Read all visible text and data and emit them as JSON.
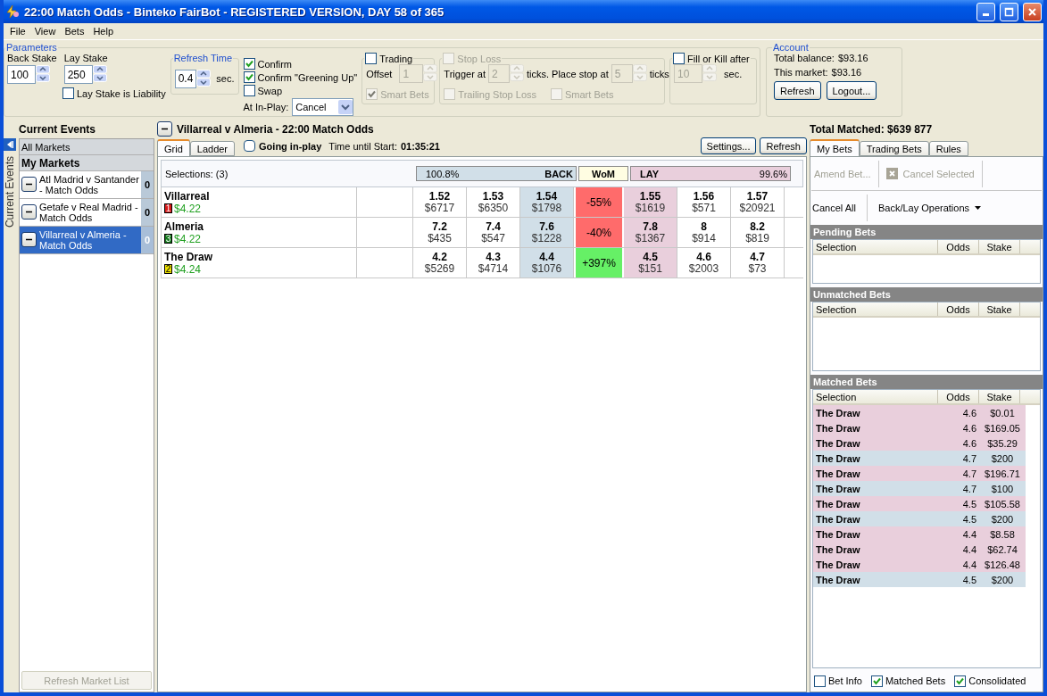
{
  "window": {
    "title": "22:00 Match Odds - Binteko FairBot - REGISTERED VERSION, DAY 58 of 365"
  },
  "menu": [
    "File",
    "View",
    "Bets",
    "Help"
  ],
  "parameters": {
    "title": "Parameters",
    "back_stake": {
      "label": "Back Stake",
      "value": "100"
    },
    "lay_stake": {
      "label": "Lay Stake",
      "value": "250"
    },
    "lay_stake_is_liability": {
      "label": "Lay Stake is Liability",
      "checked": false
    },
    "refresh_time": {
      "title": "Refresh Time",
      "value": "0.4",
      "unit": "sec."
    },
    "options": [
      {
        "label": "Confirm",
        "checked": true
      },
      {
        "label": "Confirm \"Greening Up\"",
        "checked": true
      },
      {
        "label": "Swap",
        "checked": false
      }
    ],
    "at_in_play": {
      "label": "At In-Play:",
      "value": "Cancel"
    },
    "trading": {
      "label": "Trading",
      "checked": false,
      "offset_label": "Offset",
      "offset_value": "1",
      "smart_bets": {
        "label": "Smart Bets",
        "checked": true,
        "disabled": true
      }
    },
    "stop_loss": {
      "label": "Stop Loss",
      "checked": false,
      "disabled": true,
      "trigger_label": "Trigger at",
      "trigger_value": "2",
      "trigger_unit": "ticks.",
      "place_label": "Place stop at",
      "place_value": "5",
      "place_unit": "ticks",
      "trailing": {
        "label": "Trailing Stop Loss",
        "checked": false,
        "disabled": true
      },
      "smart_bets": {
        "label": "Smart Bets",
        "checked": false,
        "disabled": true
      }
    },
    "fill_or_kill": {
      "label": "Fill or Kill after",
      "checked": false,
      "value": "10",
      "unit": "sec."
    }
  },
  "account": {
    "title": "Account",
    "total_balance_label": "Total balance:",
    "total_balance": "$93.16",
    "this_market_label": "This market:",
    "this_market": "$93.16",
    "buttons": [
      "Refresh",
      "Logout..."
    ]
  },
  "events": {
    "title": "Current Events",
    "rail_label": "Current Events",
    "all_markets": "All Markets",
    "my_markets": "My Markets",
    "markets": [
      {
        "name": "Atl Madrid v Santander - Match Odds",
        "count": "0",
        "selected": false
      },
      {
        "name": "Getafe v Real Madrid - Match Odds",
        "count": "0",
        "selected": false
      },
      {
        "name": "Villarreal v Almeria - Match Odds",
        "count": "0",
        "selected": true
      }
    ],
    "refresh_button": {
      "label": "Refresh Market List",
      "disabled": true
    }
  },
  "market": {
    "title": "Villarreal v Almeria - 22:00 Match Odds",
    "tabs": [
      {
        "label": "Grid",
        "selected": true
      },
      {
        "label": "Ladder",
        "selected": false
      }
    ],
    "going_in_play": {
      "label": "Going in-play",
      "checked": false
    },
    "time_label": "Time until Start:",
    "time_value": "01:35:21",
    "buttons": [
      "Settings...",
      "Refresh"
    ],
    "selections_label": "Selections: (3)",
    "back_percent": "100.8%",
    "back_label": "BACK",
    "wom_label": "WoM",
    "lay_label": "LAY",
    "lay_percent": "99.6%",
    "runners": [
      {
        "name": "Villarreal",
        "number": "1",
        "color": "#d81818",
        "pl": "$4.22",
        "back": [
          {
            "odds": "1.52",
            "amount": "$6717"
          },
          {
            "odds": "1.53",
            "amount": "$6350"
          },
          {
            "odds": "1.54",
            "amount": "$1798"
          }
        ],
        "wom": "-55%",
        "kind": "negative",
        "lay": [
          {
            "odds": "1.55",
            "amount": "$1619"
          },
          {
            "odds": "1.56",
            "amount": "$571"
          },
          {
            "odds": "1.57",
            "amount": "$20921"
          }
        ]
      },
      {
        "name": "Almeria",
        "number": "3",
        "color": "#107818",
        "pl": "$4.22",
        "back": [
          {
            "odds": "7.2",
            "amount": "$435"
          },
          {
            "odds": "7.4",
            "amount": "$547"
          },
          {
            "odds": "7.6",
            "amount": "$1228"
          }
        ],
        "wom": "-40%",
        "kind": "negative",
        "lay": [
          {
            "odds": "7.8",
            "amount": "$1367"
          },
          {
            "odds": "8",
            "amount": "$914"
          },
          {
            "odds": "8.2",
            "amount": "$819"
          }
        ]
      },
      {
        "name": "The Draw",
        "number": "2",
        "color": "#f0e400",
        "pl": "$4.24",
        "back": [
          {
            "odds": "4.2",
            "amount": "$5269"
          },
          {
            "odds": "4.3",
            "amount": "$4714"
          },
          {
            "odds": "4.4",
            "amount": "$1076"
          }
        ],
        "wom": "+397%",
        "kind": "positive",
        "lay": [
          {
            "odds": "4.5",
            "amount": "$151"
          },
          {
            "odds": "4.6",
            "amount": "$2003"
          },
          {
            "odds": "4.7",
            "amount": "$73"
          }
        ]
      }
    ]
  },
  "total_matched": "Total Matched: $639 877",
  "bets": {
    "tabs": [
      {
        "label": "My Bets",
        "selected": true
      },
      {
        "label": "Trading Bets",
        "selected": false
      },
      {
        "label": "Rules",
        "selected": false
      }
    ],
    "amend": {
      "label": "Amend Bet...",
      "disabled": true
    },
    "cancel_selected": {
      "label": "Cancel Selected",
      "disabled": true
    },
    "cancel_all": "Cancel All",
    "operations": "Back/Lay Operations",
    "sections": [
      {
        "title": "Pending Bets",
        "columns": [
          "Selection",
          "Odds",
          "Stake"
        ]
      },
      {
        "title": "Unmatched Bets",
        "columns": [
          "Selection",
          "Odds",
          "Stake"
        ]
      },
      {
        "title": "Matched Bets",
        "columns": [
          "Selection",
          "Odds",
          "Stake"
        ],
        "rows": [
          {
            "selection": "The Draw",
            "odds": "4.6",
            "stake": "$0.01",
            "kind": "lay"
          },
          {
            "selection": "The Draw",
            "odds": "4.6",
            "stake": "$169.05",
            "kind": "lay"
          },
          {
            "selection": "The Draw",
            "odds": "4.6",
            "stake": "$35.29",
            "kind": "lay"
          },
          {
            "selection": "The Draw",
            "odds": "4.7",
            "stake": "$200",
            "kind": "back"
          },
          {
            "selection": "The Draw",
            "odds": "4.7",
            "stake": "$196.71",
            "kind": "lay"
          },
          {
            "selection": "The Draw",
            "odds": "4.7",
            "stake": "$100",
            "kind": "back"
          },
          {
            "selection": "The Draw",
            "odds": "4.5",
            "stake": "$105.58",
            "kind": "lay"
          },
          {
            "selection": "The Draw",
            "odds": "4.5",
            "stake": "$200",
            "kind": "back"
          },
          {
            "selection": "The Draw",
            "odds": "4.4",
            "stake": "$8.58",
            "kind": "lay"
          },
          {
            "selection": "The Draw",
            "odds": "4.4",
            "stake": "$62.74",
            "kind": "lay"
          },
          {
            "selection": "The Draw",
            "odds": "4.4",
            "stake": "$126.48",
            "kind": "lay"
          },
          {
            "selection": "The Draw",
            "odds": "4.5",
            "stake": "$200",
            "kind": "back"
          }
        ]
      }
    ],
    "footer": [
      {
        "label": "Bet Info",
        "checked": false
      },
      {
        "label": "Matched Bets",
        "checked": true
      },
      {
        "label": "Consolidated",
        "checked": true
      }
    ]
  }
}
